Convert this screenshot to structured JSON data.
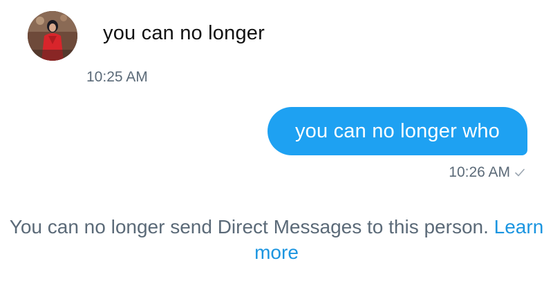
{
  "conversation": {
    "received": {
      "text": "you can no longer",
      "time": "10:25 AM",
      "avatar_icon": "user-avatar-photo"
    },
    "sent": {
      "text": "you can no longer who",
      "time": "10:26 AM",
      "status_icon": "check-icon",
      "bubble_color": "#1ea1f2"
    },
    "notice": {
      "text": "You can no longer send Direct Messages to this person.",
      "link_label": "Learn more",
      "link_color": "#1b95e0"
    }
  }
}
